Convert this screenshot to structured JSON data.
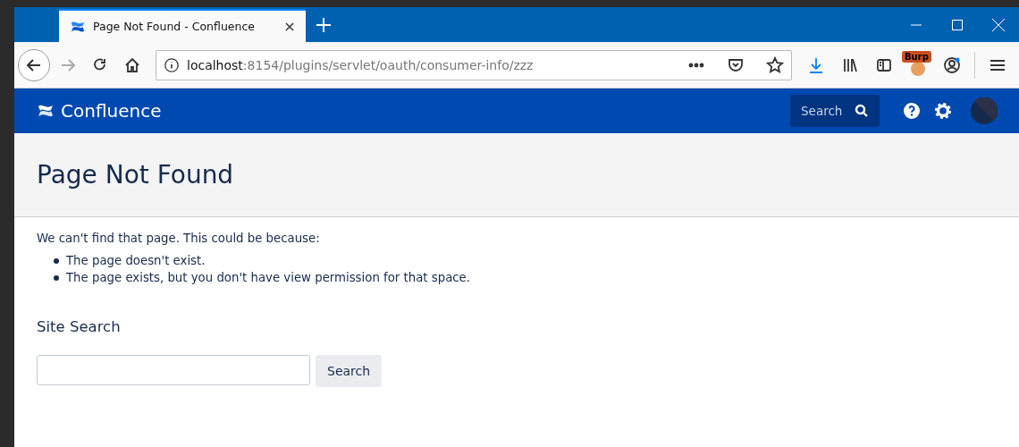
{
  "browser": {
    "tab_title": "Page Not Found - Confluence",
    "url_host": "localhost",
    "url_path": ":8154/plugins/servlet/oauth/consumer-info/zzz",
    "extension_badge": "Burp"
  },
  "header": {
    "logo": "Confluence",
    "search": {
      "placeholder": "Search"
    }
  },
  "page": {
    "title": "Page Not Found",
    "intro": "We can't find that page. This could be because:",
    "reasons": [
      "The page doesn't exist.",
      "The page exists, but you don't have view permission for that space."
    ],
    "site_search": {
      "heading": "Site Search",
      "button": "Search"
    }
  }
}
